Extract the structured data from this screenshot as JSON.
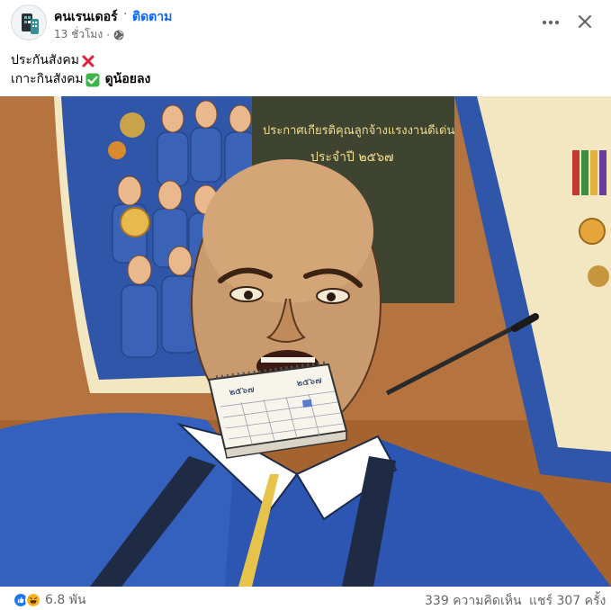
{
  "header": {
    "page_name": "คนเรนเดอร์",
    "separator": "·",
    "follow_label": "ติดตาม",
    "timestamp": "13 ชั่วโมง",
    "meta_separator": "·",
    "privacy_icon": "globe-icon",
    "more_icon": "more-options-icon",
    "close_icon": "close-icon"
  },
  "caption": {
    "line1_text": "ประกันสังคม",
    "line1_emoji": "cross-mark-icon",
    "line2_text": "เกาะกินสังคม",
    "line2_emoji": "check-mark-icon",
    "line2_bold": "ดูน้อยลง"
  },
  "image": {
    "banner_title": "ประกาศเกียรติคุณลูกจ้างแรงงานดีเด่น",
    "banner_year": "ประจำปี ๒๕๖๗",
    "calendar_year": "๒๕๖๗"
  },
  "footer": {
    "reaction_count": "6.8 พัน",
    "comments": "339 ความคิดเห็น",
    "shares": "แชร์ 307 ครั้ง"
  },
  "colors": {
    "accent": "#0866ff",
    "secondary_text": "#65676b",
    "like_blue": "#1877f2",
    "haha_yellow": "#f7b125"
  }
}
